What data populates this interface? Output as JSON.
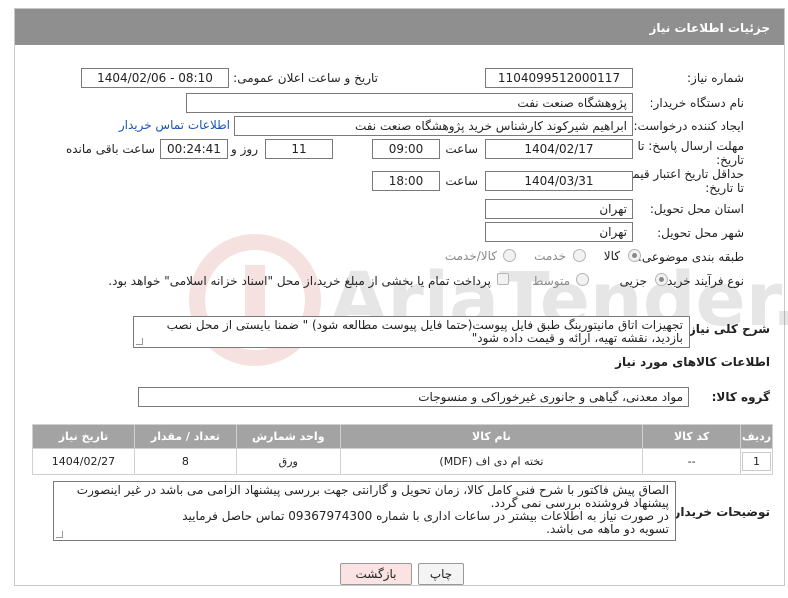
{
  "header": {
    "title": "جزئیات اطلاعات نیاز"
  },
  "form": {
    "need_number_label": "شماره نیاز:",
    "need_number": "1104099512000117",
    "announce_label": "تاریخ و ساعت اعلان عمومی:",
    "announce_value": "1404/02/06 - 08:10",
    "buyer_org_label": "نام دستگاه خریدار:",
    "buyer_org": "پژوهشگاه صنعت نفت",
    "creator_label": "ایجاد کننده درخواست:",
    "creator": "ابراهیم شیرکوند کارشناس خرید پژوهشگاه صنعت نفت",
    "buyer_contact_link": "اطلاعات تماس خریدار",
    "deadline_label_1": "مهلت ارسال پاسخ: تا",
    "deadline_label_2": "تاریخ:",
    "deadline_date": "1404/02/17",
    "time_label": "ساعت",
    "deadline_time": "09:00",
    "days_value": "11",
    "days_label": "روز و",
    "remaining_value": "00:24:41",
    "remaining_label": "ساعت باقی مانده",
    "min_validity_label_1": "حداقل تاریخ اعتبار قیمت:",
    "min_validity_label_2": "تا تاریخ:",
    "validity_date": "1404/03/31",
    "validity_time": "18:00",
    "province_label": "استان محل تحویل:",
    "province": "تهران",
    "city_label": "شهر محل تحویل:",
    "city": "تهران",
    "category_label": "طبقه بندی موضوعی:",
    "category_options": [
      "کالا",
      "خدمت",
      "کالا/خدمت"
    ],
    "process_label": "نوع فرآیند خرید :",
    "process_options": [
      "جزیی",
      "متوسط"
    ],
    "payment_note": "پرداخت تمام یا بخشی از مبلغ خرید،از محل \"اسناد خزانه اسلامی\" خواهد بود."
  },
  "description": {
    "label": "شرح کلی نیاز:",
    "line1": "تجهیزات اتاق مانیتورینگ طبق فایل پیوست(حتما فایل پیوست مطالعه شود) \" ضمنا بایستی از محل نصب",
    "line2": "بازدید، نقشه تهیه، ارائه و قیمت داده شود\""
  },
  "goods": {
    "section_title": "اطلاعات کالاهای مورد نیاز",
    "group_label": "گروه کالا:",
    "group_value": "مواد معدنی، گیاهی و جانوری غیرخوراکی و منسوجات",
    "columns": [
      "ردیف",
      "کد کالا",
      "نام کالا",
      "واحد شمارش",
      "تعداد / مقدار",
      "تاریخ نیاز"
    ],
    "rows": [
      {
        "index": "1",
        "code": "--",
        "name": "تخته ام دی اف (MDF)",
        "unit": "ورق",
        "qty": "8",
        "date": "1404/02/27"
      }
    ]
  },
  "buyer_notes": {
    "label": "توضیحات خریدار:",
    "line1": "الصاق پیش فاکتور با شرح فنی کامل کالا، زمان تحویل و گارانتی جهت بررسی پیشنهاد الزامی می باشد در غیر اینصورت",
    "line2": "پیشنهاد فروشنده بررسی نمی گردد.",
    "line3": "در صورت نیاز به اطلاعات بیشتر در ساعات اداری با شماره 09367974300 تماس حاصل فرمایید",
    "line4": "تسویه دو ماهه می باشد."
  },
  "buttons": {
    "print": "چاپ",
    "back": "بازگشت"
  },
  "colors": {
    "header_bg": "#8f8f8f",
    "table_header_bg": "#a3a3a3",
    "link": "#1a57b3",
    "back_button_bg": "#fbe3e3"
  },
  "watermark": {
    "text": "AriaTender.neT"
  }
}
